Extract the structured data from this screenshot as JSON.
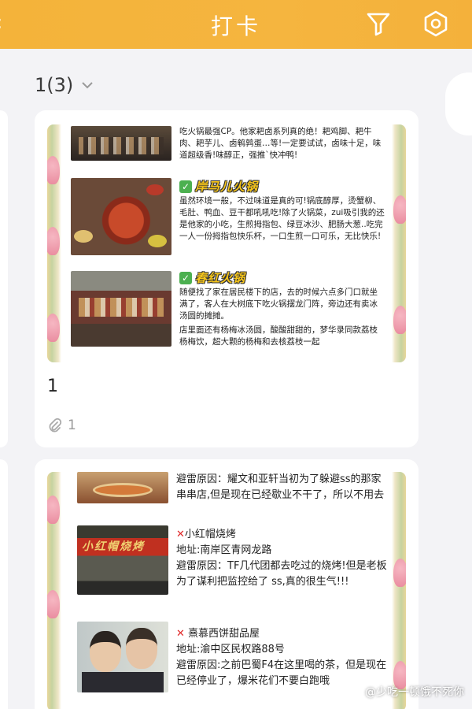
{
  "header": {
    "title": "打卡",
    "back_fragment": "‹",
    "icons": [
      "filter-icon",
      "settings-icon"
    ]
  },
  "selector": {
    "label": "1(3)"
  },
  "card1": {
    "image": {
      "intro": "吃火锅最强CP。他家耙卤系列真的绝！耙鸡脚、耙牛肉、耙芋儿、卤鹌鹑蛋…等!一定要试试，卤味十足，味道超级香!味醇正，强推`快冲鸭!",
      "sec1_title": "岸马儿火锅",
      "sec1_body": "虽然环境一般，不过味道是真的可!锅底醇厚，烫蟹柳、毛肚、鸭血、豆干都吼吼吃!除了火锅菜，zui吸引我的还是他家的小吃，生煎拇指包、绿豆冰沙、肥肠大葱..吃完一人一份拇指包快乐杯，一口生煎一口可乐，无比快乐!",
      "sec2_title": "春红火锅",
      "sec2_body1": "随便找了家在居民楼下的店，去的时候六点多门口就坐满了，客人在大树底下吃火锅摆龙门阵，旁边还有卖冰汤圆的摊摊。",
      "sec2_body2": "店里面还有杨梅冰汤圆，酸酸甜甜的，梦华录同款荔枝杨梅饮，超大颗的杨梅和去核荔枝一起"
    },
    "title": "1",
    "attachment_count": "1"
  },
  "card2": {
    "image": {
      "top_text": "避雷原因：耀文和亚轩当初为了躲避ss的那家串串店,但是现在已经歇业不干了，所以不用去",
      "item1_name": "小红帽烧烤",
      "item1_addr": "地址:南岸区青网龙路",
      "item1_reason": "避雷原因：TF几代团都去吃过的烧烤!但是老板为了谋利把监控给了 ss,真的很生气!!!",
      "item1_sign": "小红帽烧烤",
      "item2_name": "熹慕西饼甜品屋",
      "item2_addr": "地址:渝中区民权路88号",
      "item2_reason": "避雷原因:之前巴蜀F4在这里喝的茶，但是现在已经停业了，爆米花们不要白跑哦"
    }
  },
  "watermark": "@少吃一顿饿不死你",
  "colors": {
    "header": "#f4b33a",
    "background": "#f3f3f6",
    "heading_yellow": "#f5c51a",
    "check_green": "#4cb050"
  }
}
